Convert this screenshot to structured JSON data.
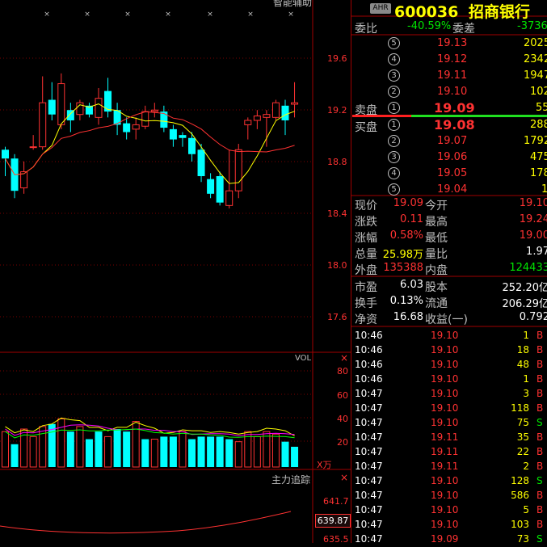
{
  "header": {
    "badge": "AHR",
    "code": "600036",
    "name": "招商银行",
    "indicator_title": "智能辅助",
    "vol_label": "VOL",
    "vol_unit": "X万",
    "main_force_label": "主力追踪"
  },
  "price_axis": [
    "19.6",
    "19.2",
    "18.8",
    "18.4",
    "18.0",
    "17.6"
  ],
  "vol_axis": [
    "80",
    "60",
    "40",
    "20"
  ],
  "mf_axis": [
    "641.7",
    "635.5"
  ],
  "mf_current": "639.87",
  "order_book": {
    "ratio_label": "委比",
    "ratio_value": "-40.59%",
    "diff_label": "委差",
    "diff_value": "-3736",
    "sell_label": "卖盘",
    "buy_label": "买盘",
    "sells": [
      {
        "level": "⑤",
        "price": "19.13",
        "vol": "2025"
      },
      {
        "level": "④",
        "price": "19.12",
        "vol": "2342"
      },
      {
        "level": "③",
        "price": "19.11",
        "vol": "1947"
      },
      {
        "level": "②",
        "price": "19.10",
        "vol": "102"
      },
      {
        "level": "①",
        "price": "19.09",
        "vol": "55"
      }
    ],
    "buys": [
      {
        "level": "①",
        "price": "19.08",
        "vol": "288"
      },
      {
        "level": "②",
        "price": "19.07",
        "vol": "1792"
      },
      {
        "level": "③",
        "price": "19.06",
        "vol": "475"
      },
      {
        "level": "④",
        "price": "19.05",
        "vol": "178"
      },
      {
        "level": "⑤",
        "price": "19.04",
        "vol": "1"
      }
    ]
  },
  "stats": [
    {
      "l1": "现价",
      "v1": "19.09",
      "c1": "red",
      "l2": "今开",
      "v2": "19.10",
      "c2": "red"
    },
    {
      "l1": "涨跌",
      "v1": "0.11",
      "c1": "red",
      "l2": "最高",
      "v2": "19.24",
      "c2": "red"
    },
    {
      "l1": "涨幅",
      "v1": "0.58%",
      "c1": "red",
      "l2": "最低",
      "v2": "19.00",
      "c2": "red"
    },
    {
      "l1": "总量",
      "v1": "25.98万",
      "c1": "yellow",
      "l2": "量比",
      "v2": "1.97",
      "c2": "white"
    },
    {
      "l1": "外盘",
      "v1": "135388",
      "c1": "red",
      "l2": "内盘",
      "v2": "124433",
      "c2": "green"
    },
    {
      "l1": "市盈",
      "v1": "6.03",
      "c1": "white",
      "l2": "股本",
      "v2": "252.20亿",
      "c2": "white"
    },
    {
      "l1": "换手",
      "v1": "0.13%",
      "c1": "white",
      "l2": "流通",
      "v2": "206.29亿",
      "c2": "white"
    },
    {
      "l1": "净资",
      "v1": "16.68",
      "c1": "white",
      "l2": "收益(一)",
      "v2": "0.792",
      "c2": "white"
    }
  ],
  "ticks": [
    {
      "t": "10:46",
      "p": "19.10",
      "v": "1",
      "s": "B"
    },
    {
      "t": "10:46",
      "p": "19.10",
      "v": "18",
      "s": "B"
    },
    {
      "t": "10:46",
      "p": "19.10",
      "v": "48",
      "s": "B"
    },
    {
      "t": "10:46",
      "p": "19.10",
      "v": "1",
      "s": "B"
    },
    {
      "t": "10:47",
      "p": "19.10",
      "v": "3",
      "s": "B"
    },
    {
      "t": "10:47",
      "p": "19.10",
      "v": "118",
      "s": "B"
    },
    {
      "t": "10:47",
      "p": "19.10",
      "v": "75",
      "s": "S"
    },
    {
      "t": "10:47",
      "p": "19.11",
      "v": "35",
      "s": "B"
    },
    {
      "t": "10:47",
      "p": "19.11",
      "v": "22",
      "s": "B"
    },
    {
      "t": "10:47",
      "p": "19.11",
      "v": "2",
      "s": "B"
    },
    {
      "t": "10:47",
      "p": "19.10",
      "v": "128",
      "s": "S"
    },
    {
      "t": "10:47",
      "p": "19.10",
      "v": "586",
      "s": "B"
    },
    {
      "t": "10:47",
      "p": "19.10",
      "v": "5",
      "s": "B"
    },
    {
      "t": "10:47",
      "p": "19.10",
      "v": "103",
      "s": "B"
    },
    {
      "t": "10:47",
      "p": "19.09",
      "v": "73",
      "s": "S"
    }
  ],
  "colors": {
    "up": "#ff3232",
    "down": "#00ffff",
    "grid": "#7a0000",
    "ma1": "#ffff00",
    "ma2": "#ff3232"
  },
  "chart_data": [
    {
      "type": "candlestick",
      "ylim": [
        17.4,
        19.8
      ],
      "candles": [
        {
          "o": 18.78,
          "c": 18.72,
          "h": 18.8,
          "l": 18.6
        },
        {
          "o": 18.72,
          "c": 18.5,
          "h": 18.75,
          "l": 18.45
        },
        {
          "o": 18.52,
          "c": 18.63,
          "h": 18.7,
          "l": 18.48
        },
        {
          "o": 18.8,
          "c": 18.8,
          "h": 18.88,
          "l": 18.78
        },
        {
          "o": 18.8,
          "c": 19.1,
          "h": 19.28,
          "l": 18.78
        },
        {
          "o": 19.12,
          "c": 19.02,
          "h": 19.24,
          "l": 18.98
        },
        {
          "o": 18.95,
          "c": 19.23,
          "h": 19.3,
          "l": 18.92
        },
        {
          "o": 19.05,
          "c": 18.98,
          "h": 19.1,
          "l": 18.9
        },
        {
          "o": 19.02,
          "c": 19.1,
          "h": 19.12,
          "l": 18.98
        },
        {
          "o": 19.08,
          "c": 19.02,
          "h": 19.1,
          "l": 19.0
        },
        {
          "o": 19.0,
          "c": 19.13,
          "h": 19.2,
          "l": 18.95
        },
        {
          "o": 19.18,
          "c": 19.04,
          "h": 19.27,
          "l": 19.0
        },
        {
          "o": 19.05,
          "c": 18.95,
          "h": 19.1,
          "l": 18.88
        },
        {
          "o": 18.96,
          "c": 18.9,
          "h": 19.0,
          "l": 18.85
        },
        {
          "o": 18.92,
          "c": 18.95,
          "h": 19.0,
          "l": 18.85
        },
        {
          "o": 18.94,
          "c": 19.04,
          "h": 19.08,
          "l": 18.92
        },
        {
          "o": 19.04,
          "c": 19.05,
          "h": 19.1,
          "l": 19.0
        },
        {
          "o": 19.04,
          "c": 18.93,
          "h": 19.08,
          "l": 18.9
        },
        {
          "o": 18.92,
          "c": 18.85,
          "h": 18.95,
          "l": 18.8
        },
        {
          "o": 18.88,
          "c": 18.86,
          "h": 18.9,
          "l": 18.8
        },
        {
          "o": 18.86,
          "c": 18.75,
          "h": 18.9,
          "l": 18.7
        },
        {
          "o": 18.78,
          "c": 18.6,
          "h": 18.82,
          "l": 18.56
        },
        {
          "o": 18.58,
          "c": 18.48,
          "h": 18.62,
          "l": 18.45
        },
        {
          "o": 18.6,
          "c": 18.42,
          "h": 18.63,
          "l": 18.4
        },
        {
          "o": 18.4,
          "c": 18.5,
          "h": 18.78,
          "l": 18.38
        },
        {
          "o": 18.5,
          "c": 18.78,
          "h": 18.82,
          "l": 18.45
        },
        {
          "o": 18.95,
          "c": 18.98,
          "h": 19.0,
          "l": 18.85
        },
        {
          "o": 18.98,
          "c": 19.01,
          "h": 19.05,
          "l": 18.92
        },
        {
          "o": 19.0,
          "c": 19.02,
          "h": 19.05,
          "l": 18.8
        },
        {
          "o": 19.0,
          "c": 19.1,
          "h": 19.12,
          "l": 18.98
        },
        {
          "o": 19.08,
          "c": 18.98,
          "h": 19.12,
          "l": 18.88
        },
        {
          "o": 19.09,
          "c": 19.1,
          "h": 19.24,
          "l": 19.0
        }
      ]
    },
    {
      "type": "bar",
      "ylim": [
        0,
        90
      ],
      "values": [
        28,
        18,
        30,
        24,
        32,
        34,
        38,
        28,
        32,
        22,
        28,
        24,
        30,
        28,
        36,
        22,
        22,
        24,
        24,
        28,
        22,
        24,
        24,
        24,
        22,
        20,
        28,
        24,
        28,
        26,
        20,
        16
      ],
      "colors": [
        "up",
        "down",
        "up",
        "up",
        "up",
        "down",
        "up",
        "down",
        "up",
        "down",
        "down",
        "up",
        "down",
        "down",
        "up",
        "down",
        "up",
        "down",
        "down",
        "up",
        "down",
        "down",
        "down",
        "down",
        "down",
        "up",
        "up",
        "up",
        "up",
        "up",
        "down",
        "down"
      ]
    }
  ]
}
